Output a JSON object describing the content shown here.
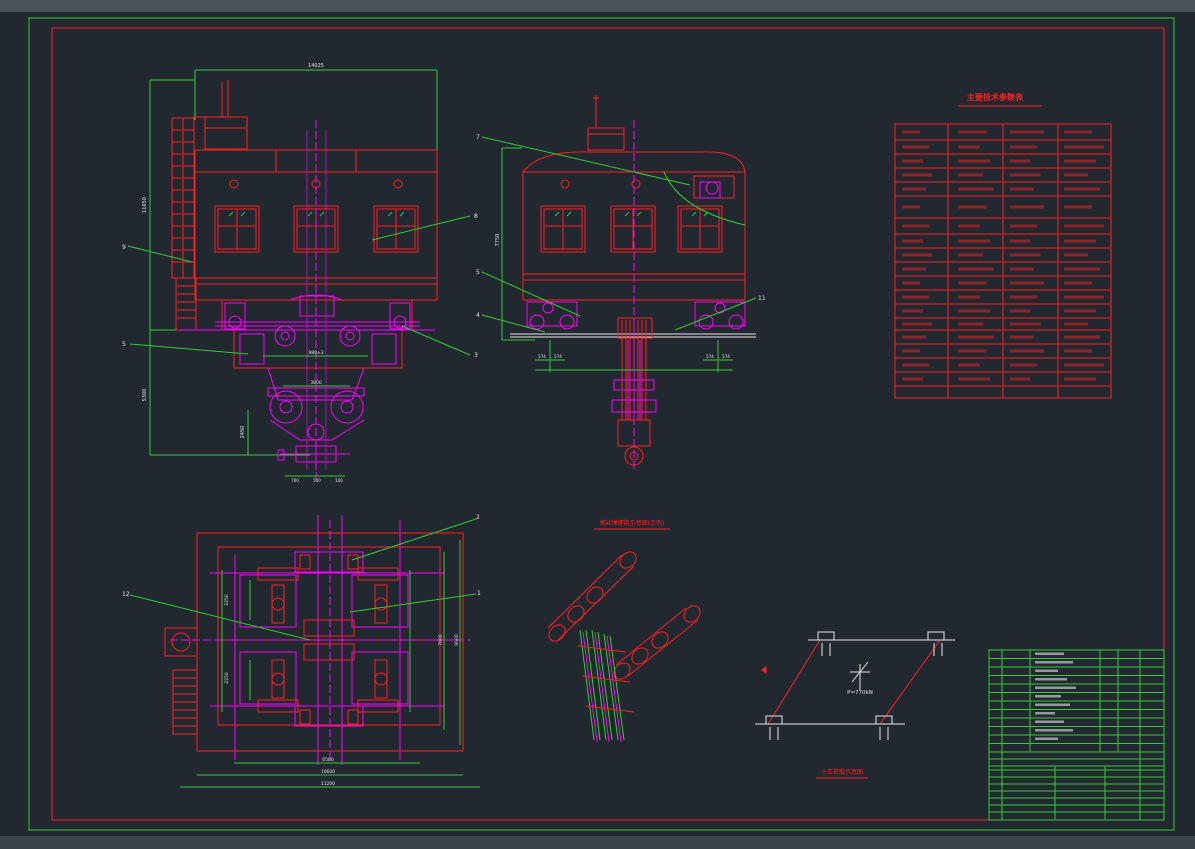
{
  "drawing": {
    "title_params": "主要技术参数表",
    "caption_rope": "钢丝绳缠绕示意图(示例)",
    "caption_load": "小车荷载示意图",
    "load_label": "P=770kN",
    "callouts": [
      "1",
      "2",
      "3",
      "4",
      "5",
      "6",
      "7",
      "8",
      "9",
      "11",
      "12"
    ],
    "dims": {
      "top_width": "14025",
      "left_height": "11650",
      "lower_height": "5300",
      "sub_height": "2450",
      "spacing_a": "980±3",
      "spacing_b": "3800",
      "bottom_a": "700",
      "bottom_b": "500",
      "bottom_c": "100",
      "side_height": "7750",
      "side_a": "574",
      "side_b": "574",
      "side_c": "574",
      "side_d": "574",
      "plan_w1": "6580",
      "plan_w2": "10600",
      "plan_w3": "11200",
      "plan_h1": "7000",
      "plan_h2": "9000",
      "plan_s1": "2250",
      "plan_s2": "2250"
    }
  },
  "colors": {
    "background": "#212830",
    "frame": "#32cd32",
    "red": "#ff2020",
    "magenta": "#ff00ff",
    "green": "#00ff40",
    "white": "#e6e6e6",
    "yellow": "#ffff00",
    "cyan": "#00ffff"
  }
}
